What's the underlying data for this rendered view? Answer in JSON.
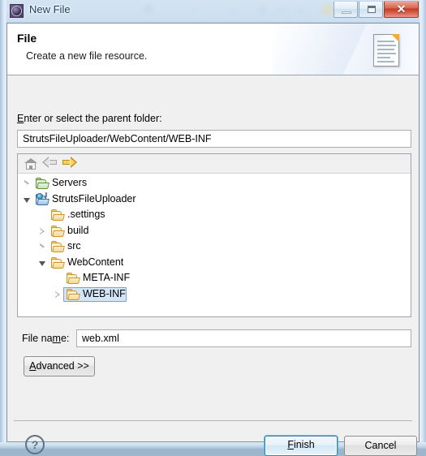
{
  "window": {
    "title": "New File",
    "icon": "eclipse-gear-icon",
    "controls": {
      "minimize": "minimize-button",
      "maximize": "maximize-button",
      "close_glyph": "✕"
    }
  },
  "header": {
    "title": "File",
    "subtitle": "Create a new file resource.",
    "icon": "new-file-document-icon"
  },
  "parent_folder": {
    "label_prefix": "",
    "label_mnemonic": "E",
    "label_rest": "nter or select the parent folder:",
    "value": "StrutsFileUploader/WebContent/WEB-INF"
  },
  "tree_toolbar": {
    "home": "home-icon",
    "back": "back-arrow-icon",
    "forward": "forward-arrow-icon"
  },
  "tree": {
    "items": [
      {
        "label": "Servers",
        "indent": 0,
        "twisty": "collapsed",
        "icon": "folder-green",
        "selected": false
      },
      {
        "label": "StrutsFileUploader",
        "indent": 0,
        "twisty": "expanded",
        "icon": "folder-project",
        "selected": false
      },
      {
        "label": ".settings",
        "indent": 1,
        "twisty": "none",
        "icon": "folder-yellow",
        "selected": false
      },
      {
        "label": "build",
        "indent": 1,
        "twisty": "collapsed",
        "icon": "folder-yellow",
        "selected": false
      },
      {
        "label": "src",
        "indent": 1,
        "twisty": "collapsed",
        "icon": "folder-yellow",
        "selected": false
      },
      {
        "label": "WebContent",
        "indent": 1,
        "twisty": "expanded",
        "icon": "folder-yellow",
        "selected": false
      },
      {
        "label": "META-INF",
        "indent": 2,
        "twisty": "none",
        "icon": "folder-yellow",
        "selected": false
      },
      {
        "label": "WEB-INF",
        "indent": 2,
        "twisty": "collapsed",
        "icon": "folder-yellow",
        "selected": true
      }
    ]
  },
  "file_name": {
    "label_prefix": "File na",
    "label_mnemonic": "m",
    "label_rest": "e:",
    "value": "web.xml"
  },
  "buttons": {
    "advanced_prefix": "",
    "advanced_mnemonic": "A",
    "advanced_rest": "dvanced >>",
    "finish_prefix": "",
    "finish_mnemonic": "F",
    "finish_rest": "inish",
    "cancel": "Cancel",
    "help": "?"
  },
  "colors": {
    "title_text": "#1c3a5c",
    "dialog_bg": "#f0f0f0",
    "selection_bg": "#d2e6f8",
    "selection_border": "#7da2c4",
    "default_button_glow": "#4fc2f0",
    "close_button": "#c13c26",
    "folder_yellow": "#c9962e"
  }
}
